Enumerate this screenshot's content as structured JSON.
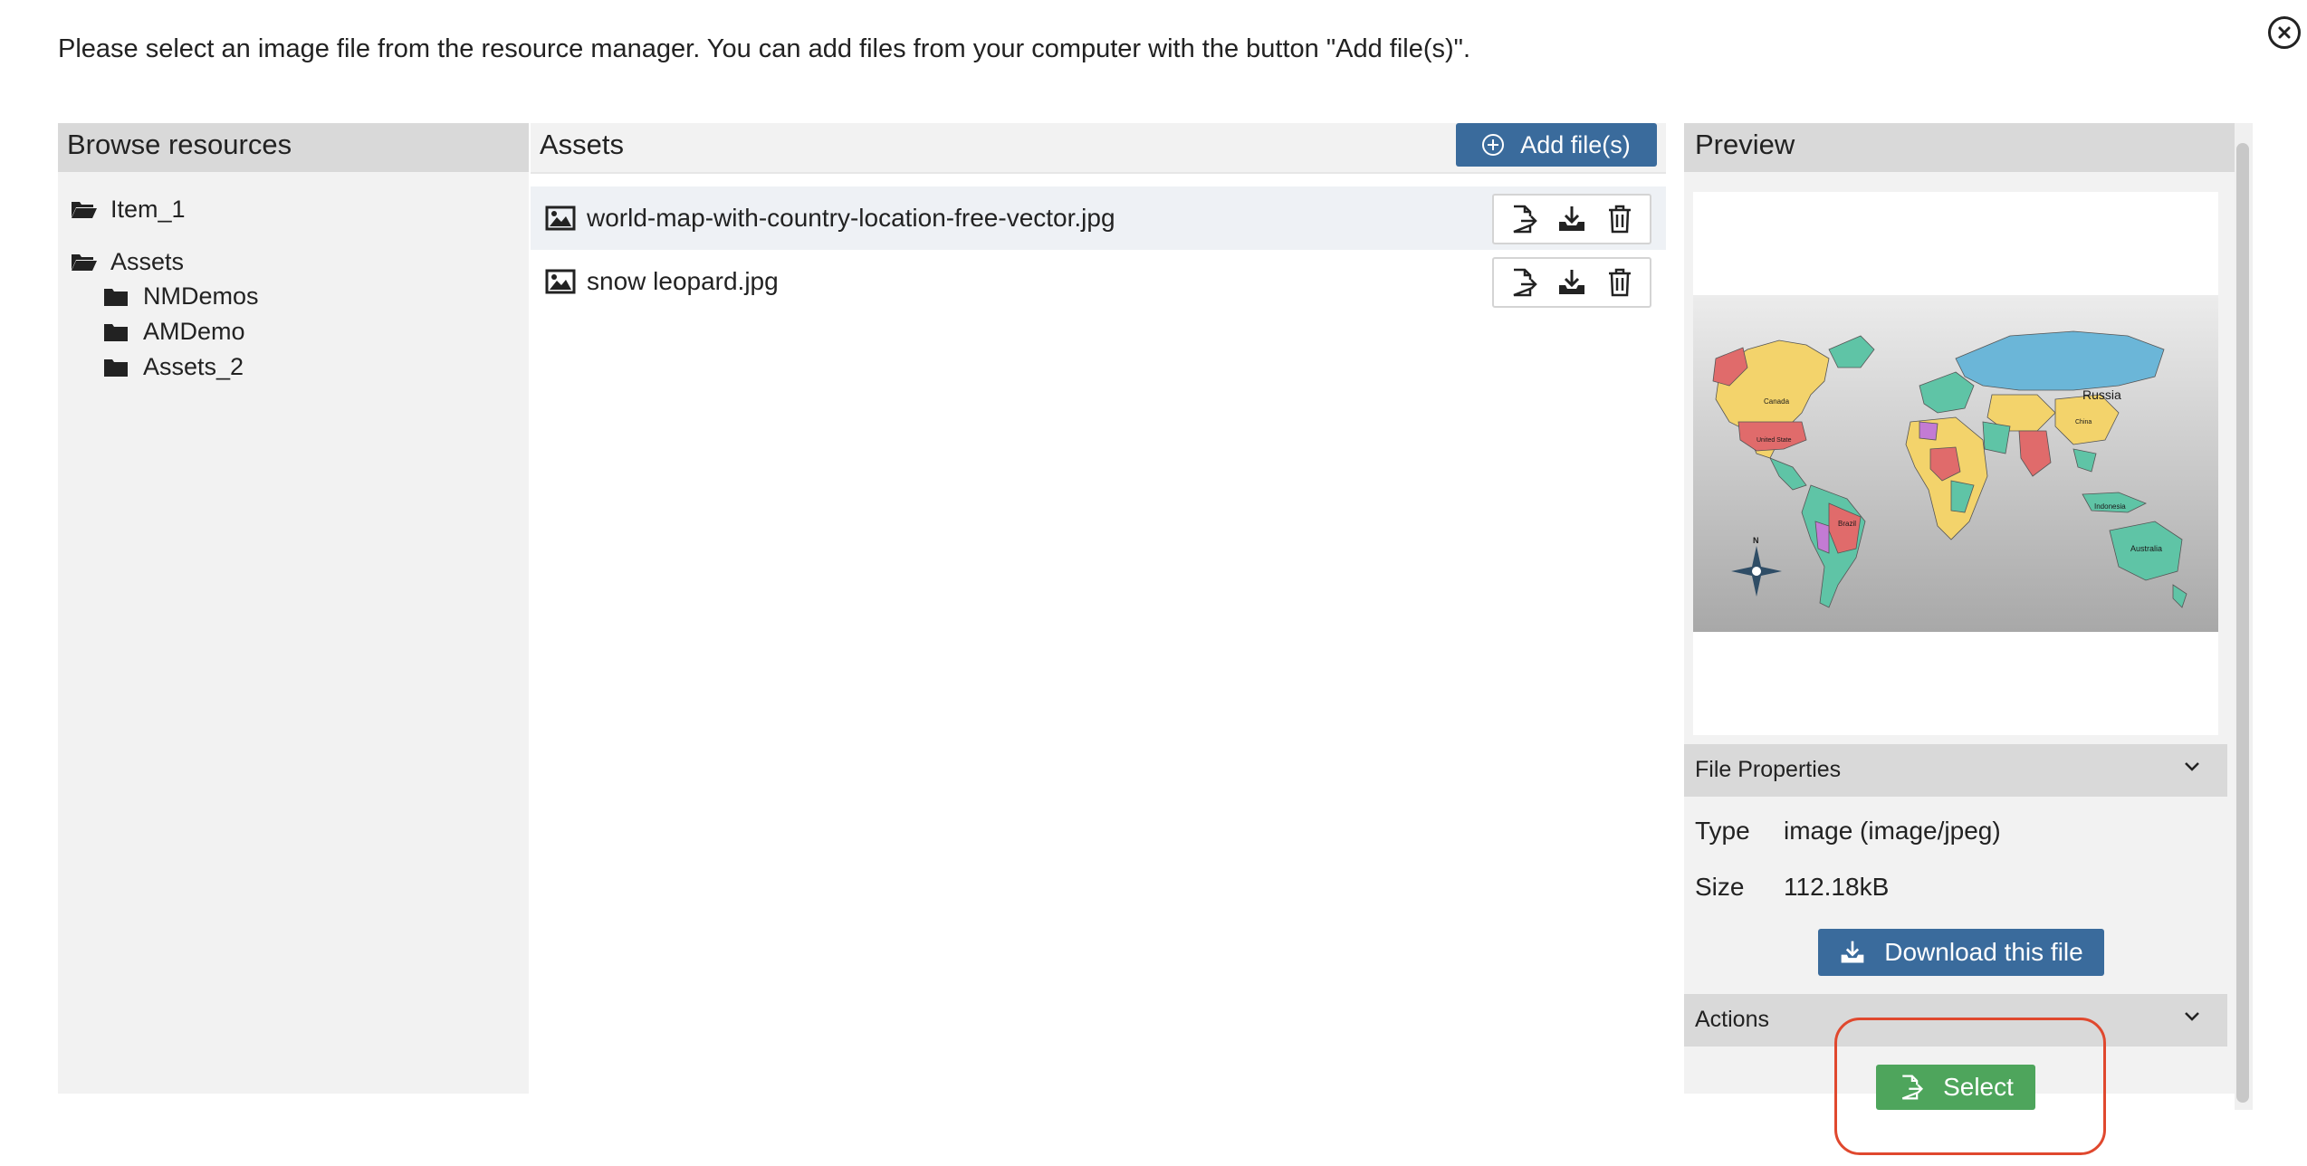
{
  "instructions": "Please select an image file from the resource manager. You can add files from your computer with the button \"Add file(s)\".",
  "browse": {
    "header": "Browse resources",
    "tree": [
      {
        "label": "Item_1",
        "icon": "folder-open-icon"
      },
      {
        "label": "Assets",
        "icon": "folder-open-icon"
      },
      {
        "label": "NMDemos",
        "icon": "folder-icon"
      },
      {
        "label": "AMDemo",
        "icon": "folder-icon"
      },
      {
        "label": "Assets_2",
        "icon": "folder-icon"
      }
    ]
  },
  "assets": {
    "header": "Assets",
    "add_label": "Add file(s)",
    "files": [
      {
        "name": "world-map-with-country-location-free-vector.jpg",
        "selected": true
      },
      {
        "name": "snow leopard.jpg",
        "selected": false
      }
    ]
  },
  "preview": {
    "header": "Preview",
    "map_labels": [
      "Russia",
      "Canada",
      "United State",
      "Brazil",
      "Indonesia",
      "Australia",
      "China",
      "N"
    ],
    "file_properties_label": "File Properties",
    "type_key": "Type",
    "type_value": "image (image/jpeg)",
    "size_key": "Size",
    "size_value": "112.18kB",
    "download_label": "Download this file",
    "actions_label": "Actions",
    "select_label": "Select"
  },
  "colors": {
    "primary": "#3a6b9c",
    "success": "#4ea55c",
    "highlight": "#e0482e"
  }
}
